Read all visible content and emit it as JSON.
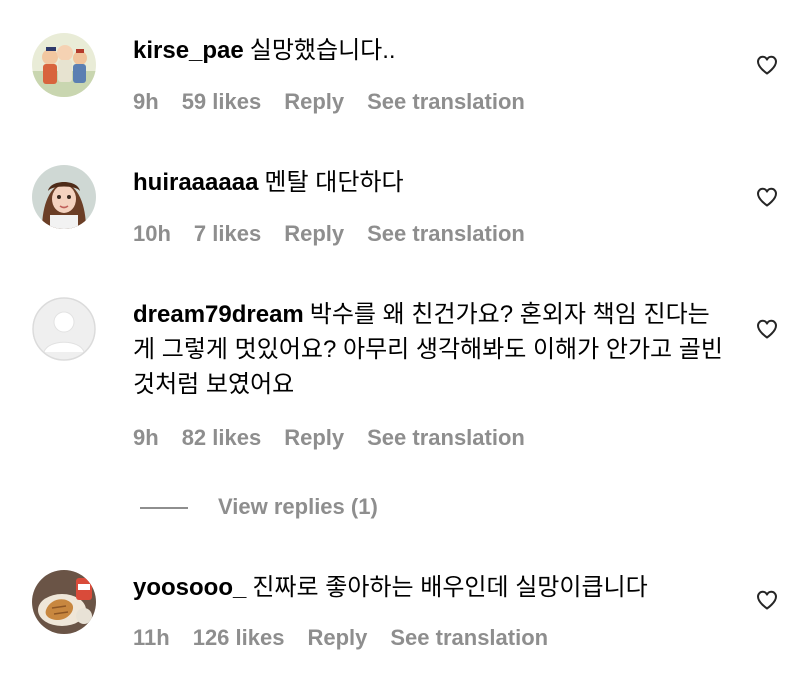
{
  "comments": [
    {
      "username": "kirse_pae",
      "text": "실망했습니다..",
      "time": "9h",
      "likes": "59 likes",
      "reply_label": "Reply",
      "translate_label": "See translation"
    },
    {
      "username": "huiraaaaaa",
      "text": "멘탈 대단하다",
      "time": "10h",
      "likes": "7 likes",
      "reply_label": "Reply",
      "translate_label": "See translation"
    },
    {
      "username": "dream79dream",
      "text": "박수를 왜 친건가요? 혼외자 책임 진다는게 그렇게 멋있어요? 아무리 생각해봐도 이해가 안가고 골빈것처럼 보였어요",
      "time": "9h",
      "likes": "82 likes",
      "reply_label": "Reply",
      "translate_label": "See translation",
      "view_replies": "View replies (1)"
    },
    {
      "username": "yoosooo_",
      "text": "진짜로 좋아하는 배우인데 실망이큽니다",
      "time": "11h",
      "likes": "126 likes",
      "reply_label": "Reply",
      "translate_label": "See translation"
    }
  ],
  "icons": {
    "like": "heart-outline-icon",
    "default_avatar": "default-avatar-icon"
  },
  "colors": {
    "text": "#000000",
    "meta": "#8e8e8e",
    "background": "#ffffff"
  }
}
